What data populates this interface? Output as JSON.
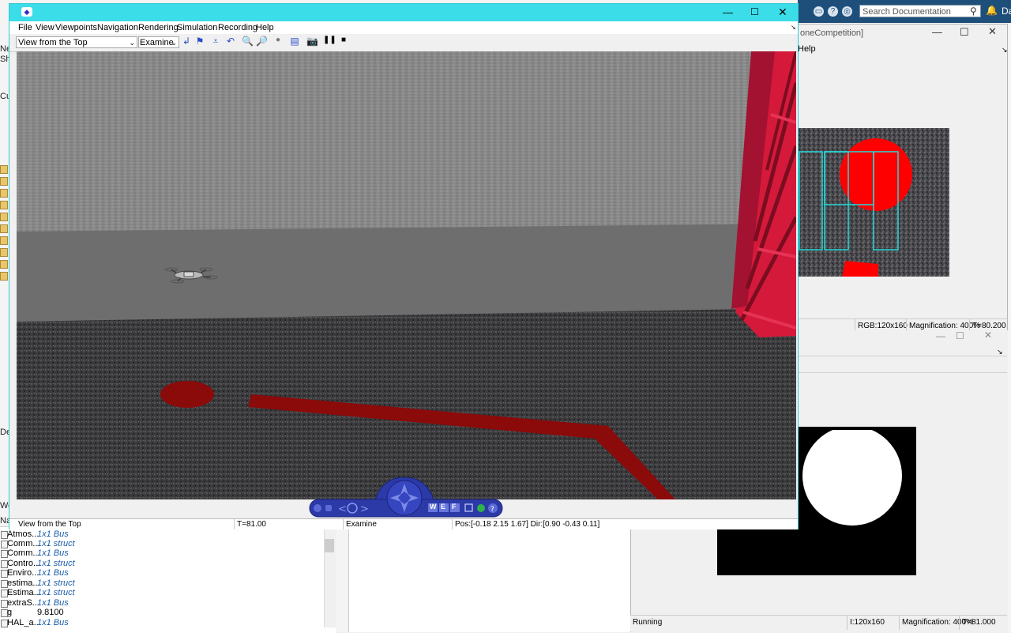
{
  "matlab": {
    "search_placeholder": "Search Documentation",
    "user_initials": "Da",
    "left_labels": [
      "Ne",
      "Shor",
      "Curr",
      "Detai",
      "Work",
      "Nam"
    ],
    "workspace_rows": [
      {
        "name": "Atmos...",
        "value": "1x1 Bus",
        "link": true
      },
      {
        "name": "Comm...",
        "value": "1x1 struct",
        "link": true
      },
      {
        "name": "Comm...",
        "value": "1x1 Bus",
        "link": true
      },
      {
        "name": "Contro...",
        "value": "1x1 struct",
        "link": true
      },
      {
        "name": "Enviro...",
        "value": "1x1 Bus",
        "link": true
      },
      {
        "name": "estima...",
        "value": "1x1 struct",
        "link": true
      },
      {
        "name": "Estima...",
        "value": "1x1 struct",
        "link": true
      },
      {
        "name": "extraS...",
        "value": "1x1 Bus",
        "link": true
      },
      {
        "name": "g",
        "value": "9.8100",
        "link": false
      },
      {
        "name": "HAL_a...",
        "value": "1x1 Bus",
        "link": true
      }
    ]
  },
  "rgb_figure": {
    "title": "oneCompetition]",
    "menu_help": "Help",
    "status_rgb": "RGB:120x160",
    "status_mag": "Magnification: 400%",
    "status_time": "T=80.200"
  },
  "binary_figure": {
    "status_state": "Running",
    "status_size": "I:120x160",
    "status_mag": "Magnification: 400%",
    "status_time": "T=81.000"
  },
  "viewer": {
    "menu": [
      "File",
      "View",
      "Viewpoints",
      "Navigation",
      "Rendering",
      "Simulation",
      "Recording",
      "Help"
    ],
    "viewpoint_value": "View from the Top",
    "mode_value": "Examine",
    "status_viewpoint": "View from the Top",
    "status_time": "T=81.00",
    "status_mode": "Examine",
    "status_pos": "Pos:[-0.18 2.15 1.67] Dir:[0.90 -0.43 0.11]",
    "nav_letters": [
      "W",
      "E",
      "F"
    ]
  },
  "colors": {
    "title_cyan": "#3bdde8",
    "matlab_blue": "#1e4f7a",
    "track_red": "#8b0a0a",
    "link_blue": "#1a5ca8"
  }
}
